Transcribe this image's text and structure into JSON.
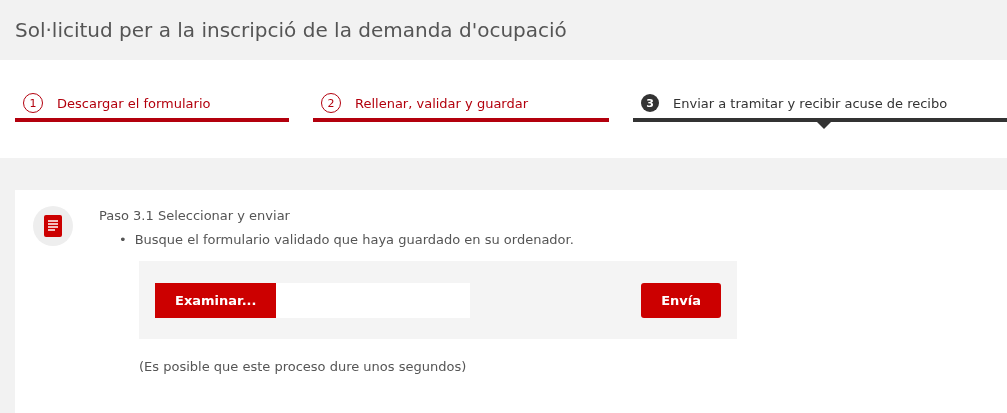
{
  "page_title": "Sol·licitud per a la inscripció de la demanda d'ocupació",
  "steps": [
    {
      "number": "1",
      "label": "Descargar el formulario",
      "selected": false
    },
    {
      "number": "2",
      "label": "Rellenar, validar y guardar",
      "selected": false
    },
    {
      "number": "3",
      "label": "Enviar a tramitar y recibir acuse de recibo",
      "selected": true
    }
  ],
  "section": {
    "heading": "Paso 3.1 Seleccionar y enviar",
    "bullets": [
      {
        "marker": "•",
        "text": "Busque el formulario validado que haya guardado en su ordenador."
      }
    ],
    "browse_button": "Examinar...",
    "send_button": "Envía",
    "note": "(Es posible que este proceso dure unos segundos)"
  }
}
